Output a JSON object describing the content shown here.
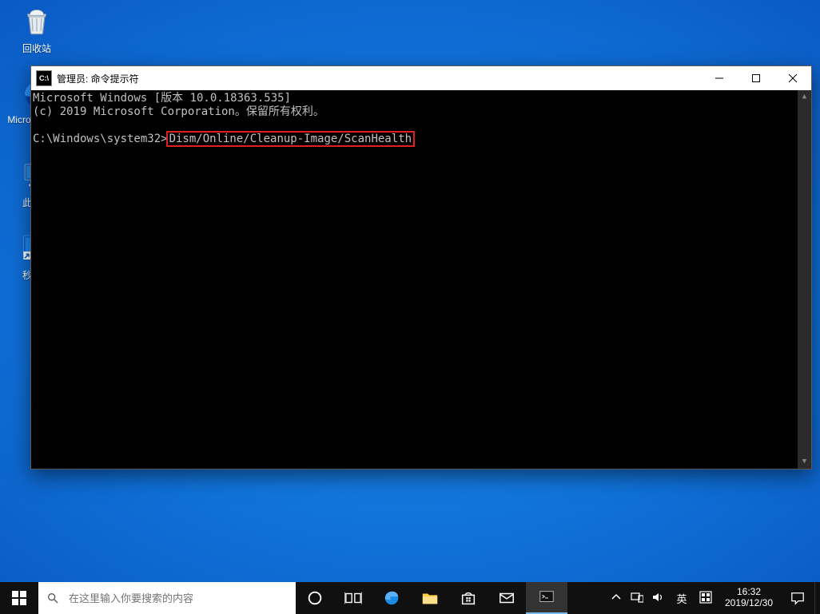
{
  "desktop_icons": {
    "recycle_bin_label": "回收站",
    "microsoft_edge_label": "Microsoft Edge",
    "this_pc_label": "此电脑",
    "seconds_shutdown_label": "秒关机"
  },
  "console": {
    "titlebar_icon_text": "C:\\",
    "title": "管理员: 命令提示符",
    "line1": "Microsoft Windows [版本 10.0.18363.535]",
    "line2": "(c) 2019 Microsoft Corporation。保留所有权利。",
    "prompt_prefix": "C:\\Windows\\system32>",
    "highlighted_command": "Dism/Online/Cleanup-Image/ScanHealth"
  },
  "taskbar": {
    "search_placeholder": "在这里输入你要搜索的内容",
    "ime_language": "英",
    "clock_time": "16:32",
    "clock_date": "2019/12/30"
  }
}
